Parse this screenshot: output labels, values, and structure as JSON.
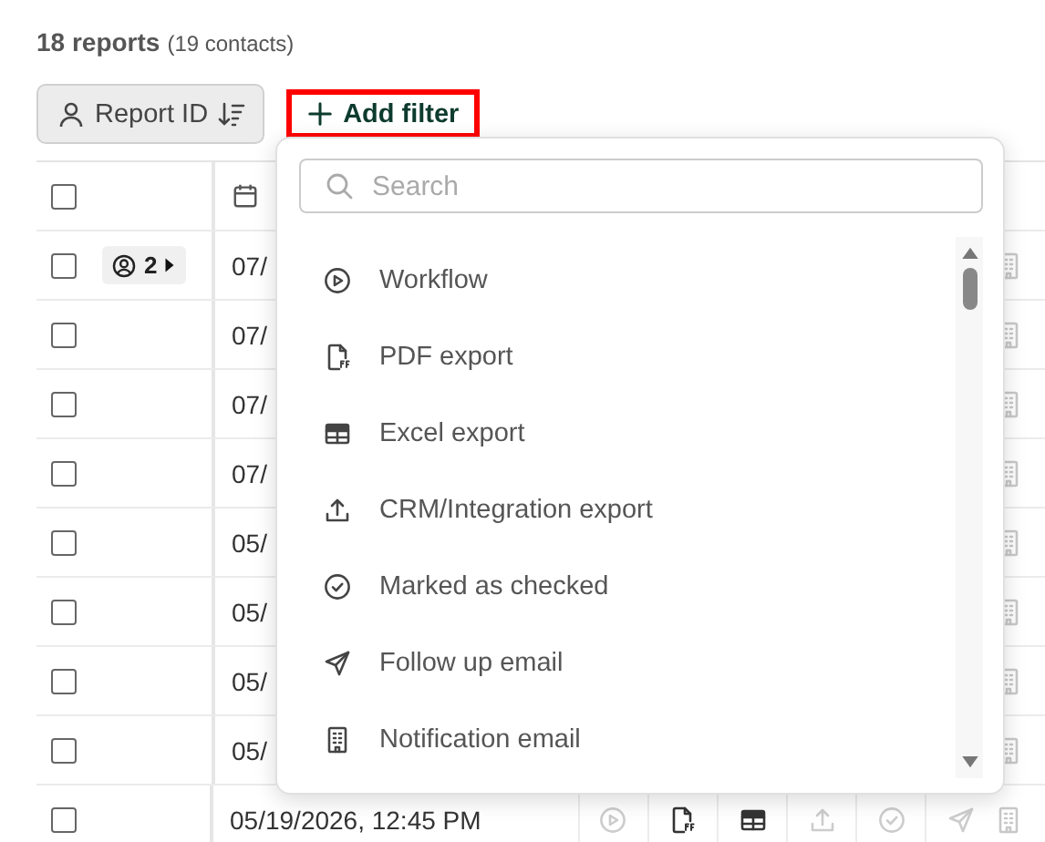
{
  "summary": {
    "reports": "18 reports",
    "contacts": "(19 contacts)"
  },
  "toolbar": {
    "sort_button": "Report ID",
    "add_filter": "Add filter"
  },
  "table": {
    "header": {
      "checked": false
    },
    "rows": [
      {
        "checked": false,
        "contacts": "2",
        "date": "07/"
      },
      {
        "checked": false,
        "date": "07/"
      },
      {
        "checked": false,
        "date": "07/"
      },
      {
        "checked": false,
        "date": "07/"
      },
      {
        "checked": false,
        "date": "05/"
      },
      {
        "checked": false,
        "date": "05/"
      },
      {
        "checked": false,
        "date": "05/"
      },
      {
        "checked": false,
        "date": "05/"
      },
      {
        "checked": false,
        "date": "05/19/2026, 12:45 PM",
        "actions": [
          {
            "kind": "workflow",
            "active": false
          },
          {
            "kind": "pdf",
            "active": true
          },
          {
            "kind": "excel",
            "active": true
          },
          {
            "kind": "upload",
            "active": false
          },
          {
            "kind": "check",
            "active": false
          },
          {
            "kind": "send",
            "active": false
          }
        ]
      }
    ]
  },
  "filter_menu": {
    "search": {
      "placeholder": "Search"
    },
    "items": [
      {
        "kind": "workflow",
        "label": "Workflow"
      },
      {
        "kind": "pdf",
        "label": "PDF export"
      },
      {
        "kind": "excel",
        "label": "Excel export"
      },
      {
        "kind": "upload",
        "label": "CRM/Integration export"
      },
      {
        "kind": "check",
        "label": "Marked as checked"
      },
      {
        "kind": "send",
        "label": "Follow up email"
      },
      {
        "kind": "building",
        "label": "Notification email"
      }
    ]
  }
}
